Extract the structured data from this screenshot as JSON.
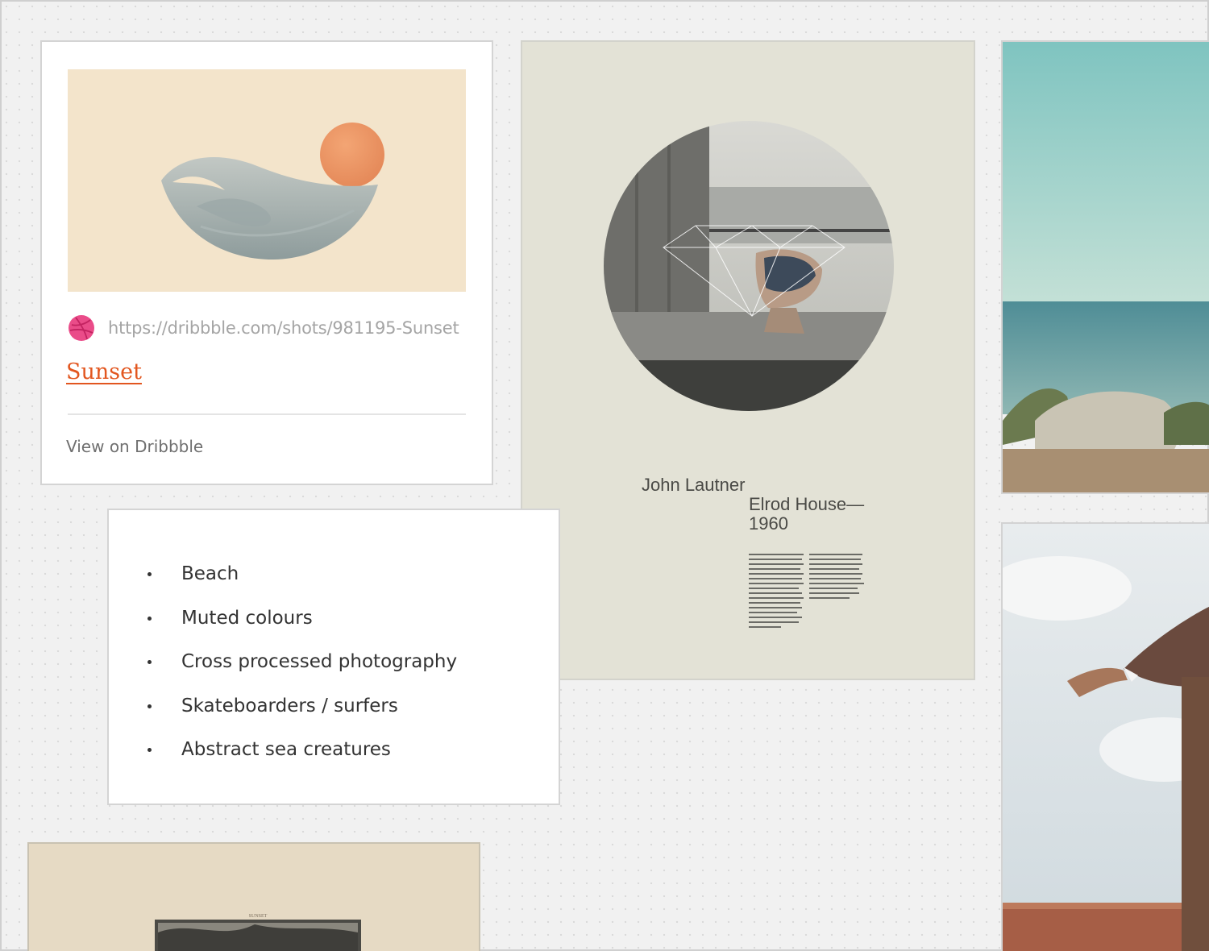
{
  "link_card": {
    "thumbnail_alt": "sunset-illustration",
    "icon": "dribbble-icon",
    "url": "https://dribbble.com/shots/981195-Sunset",
    "title": "Sunset",
    "view_label": "View on Dribbble",
    "accent_color": "#e2561f"
  },
  "poster": {
    "author": "John Lautner",
    "title_line1": "Elrod House—",
    "title_line2": "1960"
  },
  "list_card": {
    "items": [
      "Beach",
      "Muted colours",
      "Cross processed photography",
      "Skateboarders / surfers",
      "Abstract sea creatures"
    ]
  },
  "vintage": {
    "caption": "SUNSET"
  },
  "colors": {
    "background": "#f1f1f1",
    "card": "#ffffff",
    "poster_bg": "#e3e2d6",
    "dribbble_pink": "#ea4c89"
  }
}
